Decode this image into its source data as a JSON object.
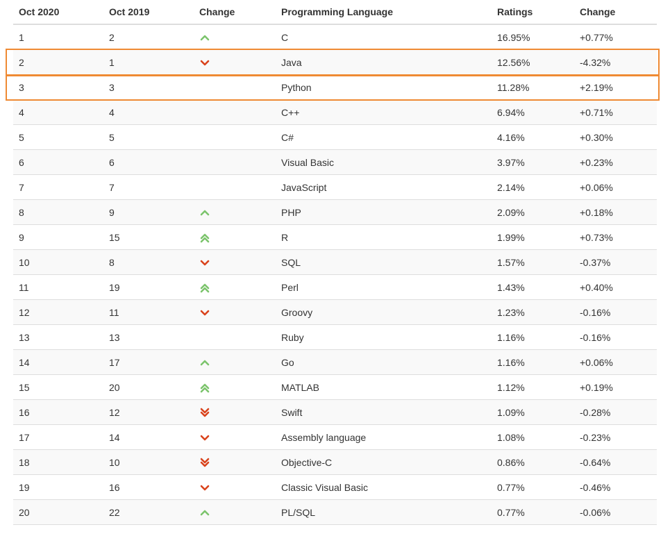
{
  "colors": {
    "up": "#7cc46c",
    "down": "#d9431c",
    "highlight": "#ef8a33",
    "border": "#dddddd"
  },
  "header": {
    "col_now": "Oct 2020",
    "col_prev": "Oct 2019",
    "col_change": "Change",
    "col_language": "Programming Language",
    "col_ratings": "Ratings",
    "col_delta": "Change"
  },
  "rows": [
    {
      "now": "1",
      "prev": "2",
      "trend": "up",
      "trend_icon": "chevron-up-icon",
      "language": "C",
      "rating": "16.95%",
      "delta": "+0.77%"
    },
    {
      "now": "2",
      "prev": "1",
      "trend": "down",
      "trend_icon": "chevron-down-icon",
      "language": "Java",
      "rating": "12.56%",
      "delta": "-4.32%"
    },
    {
      "now": "3",
      "prev": "3",
      "trend": "none",
      "trend_icon": "",
      "language": "Python",
      "rating": "11.28%",
      "delta": "+2.19%"
    },
    {
      "now": "4",
      "prev": "4",
      "trend": "none",
      "trend_icon": "",
      "language": "C++",
      "rating": "6.94%",
      "delta": "+0.71%"
    },
    {
      "now": "5",
      "prev": "5",
      "trend": "none",
      "trend_icon": "",
      "language": "C#",
      "rating": "4.16%",
      "delta": "+0.30%"
    },
    {
      "now": "6",
      "prev": "6",
      "trend": "none",
      "trend_icon": "",
      "language": "Visual Basic",
      "rating": "3.97%",
      "delta": "+0.23%"
    },
    {
      "now": "7",
      "prev": "7",
      "trend": "none",
      "trend_icon": "",
      "language": "JavaScript",
      "rating": "2.14%",
      "delta": "+0.06%"
    },
    {
      "now": "8",
      "prev": "9",
      "trend": "up",
      "trend_icon": "chevron-up-icon",
      "language": "PHP",
      "rating": "2.09%",
      "delta": "+0.18%"
    },
    {
      "now": "9",
      "prev": "15",
      "trend": "double-up",
      "trend_icon": "double-chevron-up-icon",
      "language": "R",
      "rating": "1.99%",
      "delta": "+0.73%"
    },
    {
      "now": "10",
      "prev": "8",
      "trend": "down",
      "trend_icon": "chevron-down-icon",
      "language": "SQL",
      "rating": "1.57%",
      "delta": "-0.37%"
    },
    {
      "now": "11",
      "prev": "19",
      "trend": "double-up",
      "trend_icon": "double-chevron-up-icon",
      "language": "Perl",
      "rating": "1.43%",
      "delta": "+0.40%"
    },
    {
      "now": "12",
      "prev": "11",
      "trend": "down",
      "trend_icon": "chevron-down-icon",
      "language": "Groovy",
      "rating": "1.23%",
      "delta": "-0.16%"
    },
    {
      "now": "13",
      "prev": "13",
      "trend": "none",
      "trend_icon": "",
      "language": "Ruby",
      "rating": "1.16%",
      "delta": "-0.16%"
    },
    {
      "now": "14",
      "prev": "17",
      "trend": "up",
      "trend_icon": "chevron-up-icon",
      "language": "Go",
      "rating": "1.16%",
      "delta": "+0.06%"
    },
    {
      "now": "15",
      "prev": "20",
      "trend": "double-up",
      "trend_icon": "double-chevron-up-icon",
      "language": "MATLAB",
      "rating": "1.12%",
      "delta": "+0.19%"
    },
    {
      "now": "16",
      "prev": "12",
      "trend": "double-down",
      "trend_icon": "double-chevron-down-icon",
      "language": "Swift",
      "rating": "1.09%",
      "delta": "-0.28%"
    },
    {
      "now": "17",
      "prev": "14",
      "trend": "down",
      "trend_icon": "chevron-down-icon",
      "language": "Assembly language",
      "rating": "1.08%",
      "delta": "-0.23%"
    },
    {
      "now": "18",
      "prev": "10",
      "trend": "double-down",
      "trend_icon": "double-chevron-down-icon",
      "language": "Objective-C",
      "rating": "0.86%",
      "delta": "-0.64%"
    },
    {
      "now": "19",
      "prev": "16",
      "trend": "down",
      "trend_icon": "chevron-down-icon",
      "language": "Classic Visual Basic",
      "rating": "0.77%",
      "delta": "-0.46%"
    },
    {
      "now": "20",
      "prev": "22",
      "trend": "up",
      "trend_icon": "chevron-up-icon",
      "language": "PL/SQL",
      "rating": "0.77%",
      "delta": "-0.06%"
    }
  ],
  "highlighted_rows": [
    "Java",
    "Python"
  ]
}
